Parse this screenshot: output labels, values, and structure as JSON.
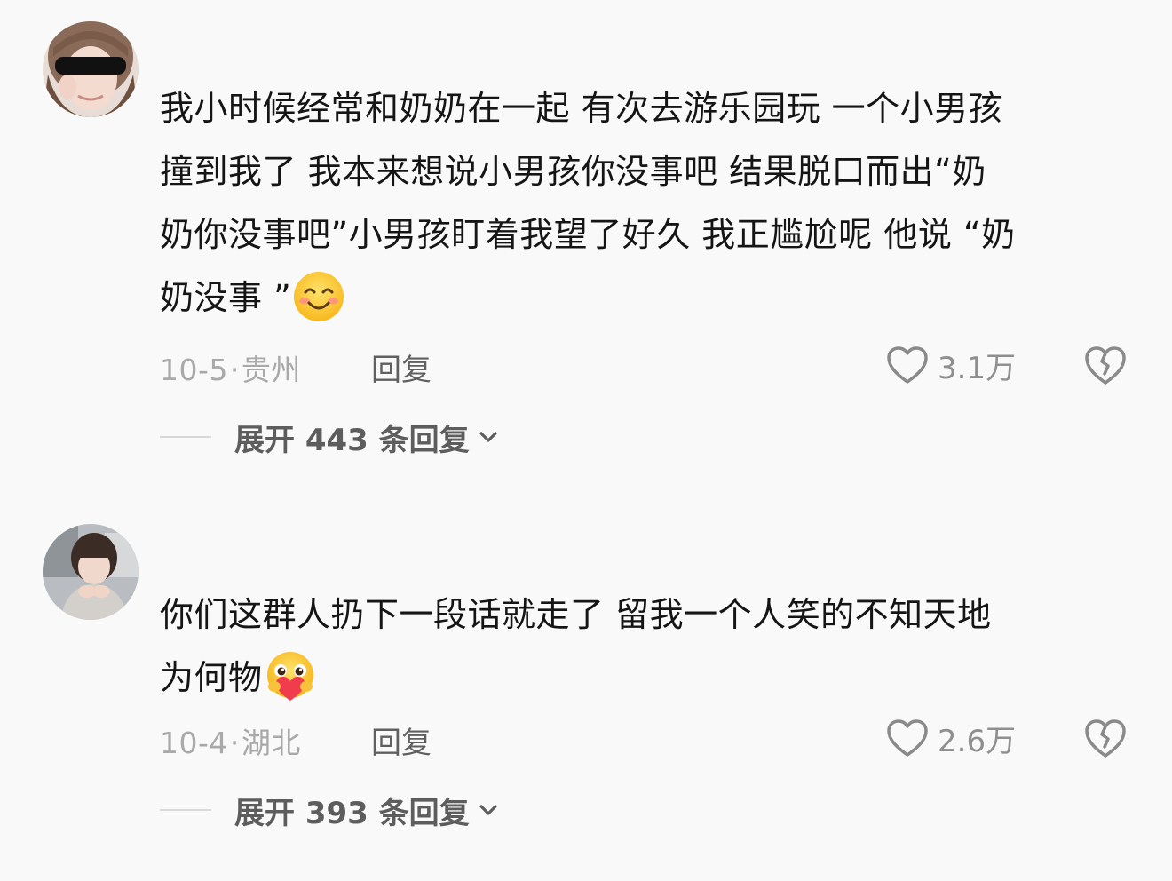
{
  "comments": [
    {
      "text": "我小时候经常和奶奶在一起 有次去游乐园玩 一个小男孩撞到我了 我本来想说小男孩你没事吧 结果脱口而出“奶奶你没事吧”小男孩盯着我望了好久 我正尴尬呢 他说 “奶奶没事 ”",
      "lines": [
        "我小时候经常和奶奶在一起 有次去游乐园玩 一个小男孩",
        "撞到我了 我本来想说小男孩你没事吧 结果脱口而出“奶",
        "奶你没事吧”小男孩盯着我望了好久 我正尴尬呢 他说 “奶",
        "奶没事 ”"
      ],
      "emoji": "smile-emoji",
      "date": "10-5",
      "separator": "·",
      "location": "贵州",
      "reply_label": "回复",
      "like_count": "3.1万",
      "expand_label": "展开 443 条回复"
    },
    {
      "text": "你们这群人扔下一段话就走了 留我一个人笑的不知天地为何物",
      "lines": [
        "你们这群人扔下一段话就走了 留我一个人笑的不知天地",
        "为何物"
      ],
      "emoji": "hug-heart-emoji",
      "date": "10-4",
      "separator": "·",
      "location": "湖北",
      "reply_label": "回复",
      "like_count": "2.6万",
      "expand_label": "展开 393 条回复"
    }
  ],
  "colors": {
    "background": "#f9f9f9",
    "text": "#151515",
    "meta": "#a9a9a9",
    "action": "#606060"
  },
  "icons": {
    "like": "heart-outline-icon",
    "dislike": "broken-heart-icon",
    "expand": "chevron-down-icon"
  }
}
